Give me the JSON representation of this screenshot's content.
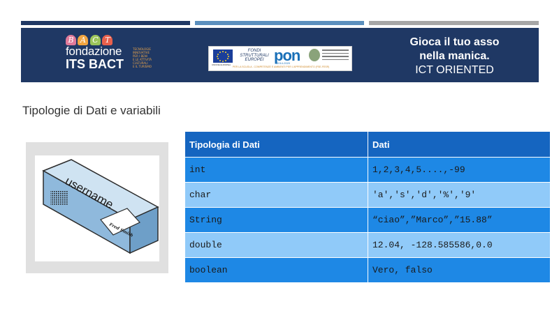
{
  "banner": {
    "logo": {
      "letters": [
        "B",
        "A",
        "C",
        "T"
      ],
      "line1": "fondazione",
      "line2": "ITS BACT",
      "tagline": "TECNOLOGIE\nINNOVATIVE\nPER I BENI\nE LE ATTIVITÀ\nCULTURALI\nE IL TURISMO"
    },
    "pon": {
      "eu_caption": "UNIONE EUROPEA",
      "fondi": "FONDI\nSTRUTTURALI\nEUROPEI",
      "mark": "pon",
      "years": "2014-2020",
      "caption": "PER LA SCUOLA - COMPETENZE E AMBIENTI PER L'APPRENDIMENTO (FSE-FESR)",
      "emblem_label": "MIUR"
    },
    "slogan": {
      "line1": "Gioca il tuo asso",
      "line2": "nella manica.",
      "line3": "ICT ORIENTED"
    }
  },
  "heading": "Tipologie di Dati e variabili",
  "illustration": {
    "box_label": "username",
    "card_label": "Fred Smith"
  },
  "table": {
    "headers": [
      "Tipologia di Dati",
      "Dati"
    ],
    "rows": [
      [
        "int",
        "1,2,3,4,5....,-99"
      ],
      [
        "char",
        "'a','s','d','%','9'"
      ],
      [
        "String",
        "“ciao”,”Marco”,”15.88”"
      ],
      [
        "double",
        "12.04, -128.585586,0.0"
      ],
      [
        "boolean",
        "Vero, falso"
      ]
    ]
  },
  "colors": {
    "banner_bg": "#1f3864",
    "header_blue": "#1565c0",
    "row_dark": "#1e88e5",
    "row_light": "#90caf9",
    "bar_mid": "#5b8fbd",
    "bar_grey": "#a6a6a6"
  }
}
